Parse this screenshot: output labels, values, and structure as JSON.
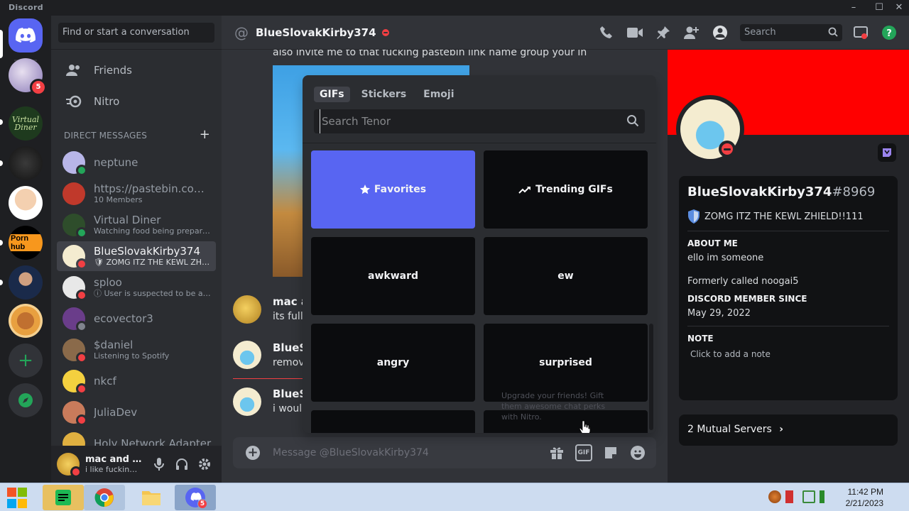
{
  "window": {
    "app_name": "Discord",
    "minimize": "–",
    "maximize": "☐",
    "close": "✕"
  },
  "rail": {
    "home_icon": "discord-logo-icon",
    "badges": [
      "5"
    ],
    "servers": [
      "Virtual Diner",
      "Porn hub",
      "burger"
    ],
    "add_icon": "plus-icon",
    "explore_icon": "compass-icon"
  },
  "sidebar": {
    "search_placeholder": "Find or start a conversation",
    "nav": [
      {
        "label": "Friends",
        "icon": "friends-icon"
      },
      {
        "label": "Nitro",
        "icon": "nitro-icon"
      }
    ],
    "dm_header": "DIRECT MESSAGES",
    "dm_add": "+",
    "dms": [
      {
        "name": "neptune",
        "sub": "",
        "status": "online",
        "color": "#b8b6e8"
      },
      {
        "name": "https://pastebin.com/...",
        "sub": "10 Members",
        "status": "",
        "color": "#c0392b"
      },
      {
        "name": "Virtual Diner",
        "sub": "Watching food being prepared!",
        "status": "online",
        "color": "#2e4d2b"
      },
      {
        "name": "BlueSlovakKirby374",
        "sub": "🛡 ZOMG ITZ THE KEWL ZHIELD!!111",
        "status": "dnd",
        "color": "#f4ecd0"
      },
      {
        "name": "sploo",
        "sub": "ⓘ User is suspected to be a tr...",
        "status": "dnd",
        "color": "#e8e8e8"
      },
      {
        "name": "ecovector3",
        "sub": "",
        "status": "offline",
        "color": "#6a3d8a"
      },
      {
        "name": "$daniel",
        "sub": "Listening to Spotify",
        "status": "dnd",
        "color": "#8a6a4a"
      },
      {
        "name": "nkcf",
        "sub": "",
        "status": "dnd",
        "color": "#f4d03f"
      },
      {
        "name": "JuliaDev",
        "sub": "",
        "status": "dnd",
        "color": "#c97b5b"
      },
      {
        "name": "Holy Network Adapter",
        "sub": "",
        "status": "",
        "color": "#e0b040"
      }
    ]
  },
  "user_panel": {
    "name": "mac and c...",
    "sub": "i like fucking ..."
  },
  "chat_header": {
    "name": "BlueSlovakKirby374",
    "search_placeholder": "Search"
  },
  "chat": {
    "first_line": "also invite me to that fucking pastebin link name group your in",
    "messages": [
      {
        "author": "mac a",
        "text": "its full",
        "avatar_color": "#e0b040"
      },
      {
        "author": "BlueSl",
        "text": "remov",
        "avatar_color": "#f4ecd0"
      },
      {
        "author": "BlueSl",
        "text": "i woul",
        "avatar_color": "#f4ecd0"
      }
    ],
    "composer_placeholder": "Message @BlueSlovakKirby374",
    "gif_label": "GIF"
  },
  "picker": {
    "tabs": [
      "GIFs",
      "Stickers",
      "Emoji"
    ],
    "active_tab": "GIFs",
    "search_placeholder": "Search Tenor",
    "tiles": [
      {
        "label": "Favorites",
        "icon": "star-icon"
      },
      {
        "label": "Trending GIFs",
        "icon": "trending-icon"
      },
      {
        "label": "awkward"
      },
      {
        "label": "ew"
      },
      {
        "label": "angry"
      },
      {
        "label": "surprised"
      }
    ],
    "tooltip": "Upgrade your friends! Gift them awesome chat perks with Nitro."
  },
  "profile": {
    "username": "BlueSlovakKirby374",
    "discriminator": "#8969",
    "custom_status": "ZOMG ITZ THE KEWL ZHIELD!!111",
    "about_title": "ABOUT ME",
    "about_1": "ello im someone",
    "about_2": "Formerly called noogai5",
    "member_since_title": "DISCORD MEMBER SINCE",
    "member_since": "May 29, 2022",
    "note_title": "NOTE",
    "note_placeholder": "Click to add a note",
    "mutual": "2 Mutual Servers",
    "banner_color": "#ff0000"
  },
  "taskbar": {
    "time": "11:42 PM",
    "date": "2/21/2023",
    "discord_badge": "5"
  }
}
